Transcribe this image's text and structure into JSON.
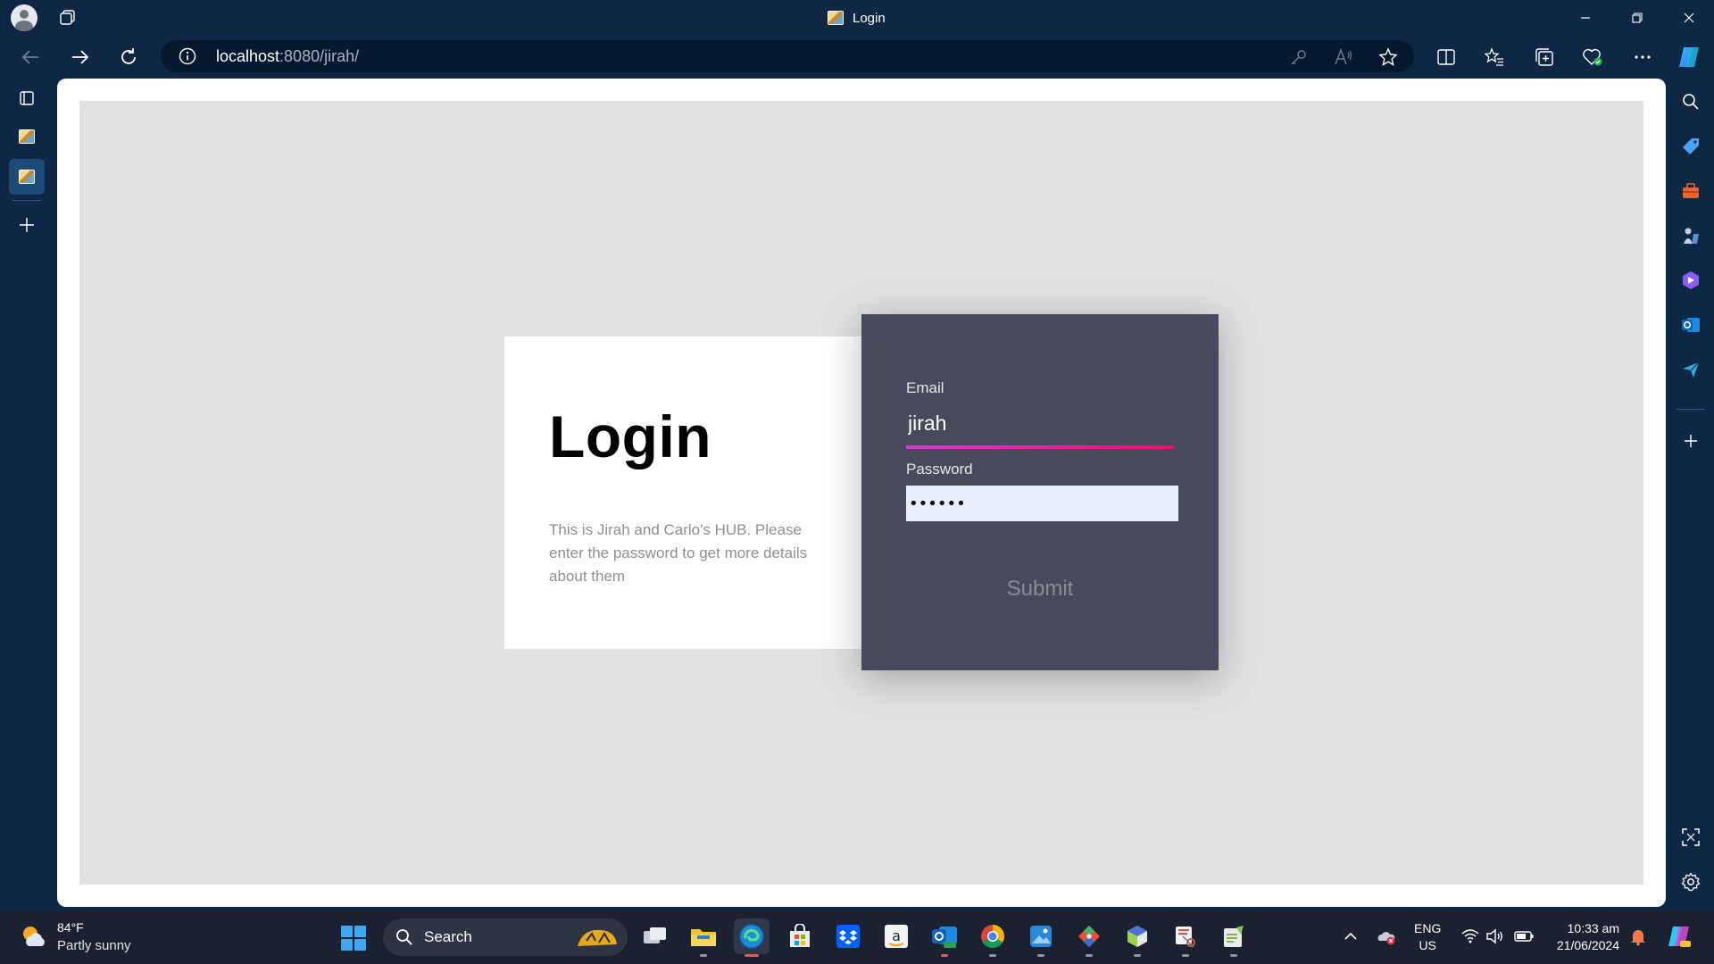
{
  "window": {
    "tab_title": "Login",
    "favicon": "site-favicon"
  },
  "address_bar": {
    "host": "localhost",
    "path": ":8080/jirah/"
  },
  "page": {
    "heading": "Login",
    "description": "This is Jirah and Carlo's HUB. Please enter the password to get more details about them",
    "form": {
      "email_label": "Email",
      "email_value": "jirah",
      "password_label": "Password",
      "password_value": "••••••",
      "submit_label": "Submit"
    }
  },
  "colors": {
    "form_panel": "#474a5a",
    "stage": "#e1e1e3",
    "underline_start": "#d43ad8",
    "underline_end": "#ef0f6a",
    "password_fill": "#e8f0fe"
  },
  "taskbar": {
    "weather_temp": "84°F",
    "weather_condition": "Partly sunny",
    "search_label": "Search",
    "language_line1": "ENG",
    "language_line2": "US",
    "time": "10:33 am",
    "date": "21/06/2024",
    "apps": [
      "file-explorer-icon",
      "edge-icon",
      "microsoft-store-icon",
      "dropbox-icon",
      "amazon-icon",
      "outlook-new-icon",
      "chrome-icon",
      "photos-icon",
      "git-icon",
      "cube-app-icon",
      "snipping-tool-icon",
      "notepad-plus-icon"
    ]
  }
}
